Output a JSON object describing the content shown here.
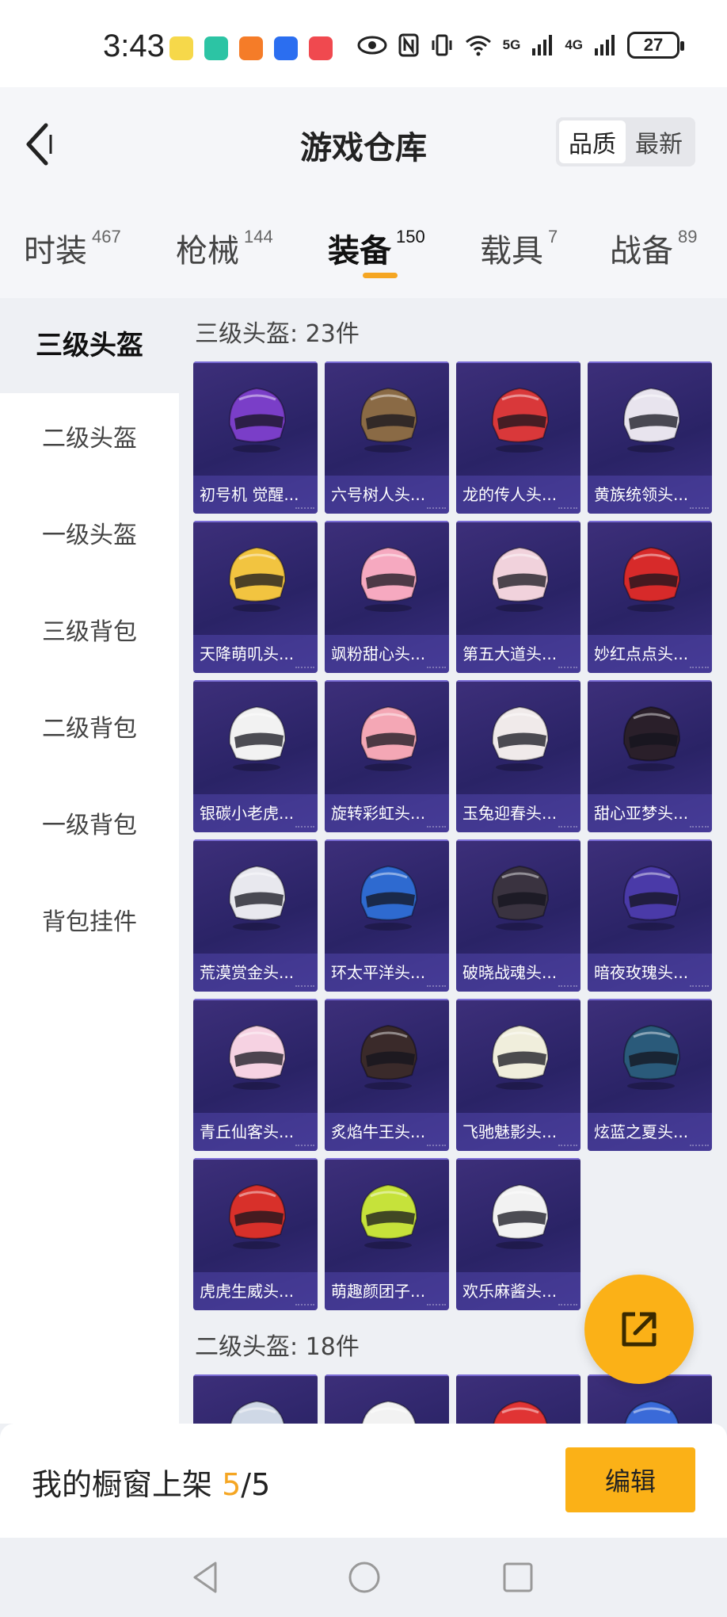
{
  "status_bar": {
    "time": "3:43",
    "network_1": "5G",
    "network_2": "4G",
    "battery": "27"
  },
  "header": {
    "title": "游戏仓库",
    "sort_options": [
      "品质",
      "最新"
    ]
  },
  "category_tabs": [
    {
      "label": "时装",
      "count": "467"
    },
    {
      "label": "枪械",
      "count": "144"
    },
    {
      "label": "装备",
      "count": "150"
    },
    {
      "label": "载具",
      "count": "7"
    },
    {
      "label": "战备",
      "count": "89"
    }
  ],
  "sidebar": {
    "items": [
      "三级头盔",
      "二级头盔",
      "一级头盔",
      "三级背包",
      "二级背包",
      "一级背包",
      "背包挂件"
    ]
  },
  "sections": [
    {
      "title": "三级头盔: 23件",
      "items": [
        "初号机 觉醒...",
        "六号树人头...",
        "龙的传人头...",
        "黄族统领头...",
        "天降萌叽头...",
        "飒粉甜心头...",
        "第五大道头...",
        "妙红点点头...",
        "银碳小老虎...",
        "旋转彩虹头...",
        "玉兔迎春头...",
        "甜心亚梦头...",
        "荒漠赏金头...",
        "环太平洋头...",
        "破晓战魂头...",
        "暗夜玫瑰头...",
        "青丘仙客头...",
        "炙焰牛王头...",
        "飞驰魅影头...",
        "炫蓝之夏头...",
        "虎虎生威头...",
        "萌趣颜团子...",
        "欢乐麻酱头..."
      ]
    },
    {
      "title": "二级头盔: 18件"
    }
  ],
  "bottom_bar": {
    "label": "我的橱窗上架",
    "count": "5",
    "total": "/5",
    "edit_label": "编辑"
  },
  "helmet_colors": [
    "#7a3ec8",
    "#8a6a45",
    "#d9383a",
    "#e8e4ee",
    "#f2c440",
    "#f6a9c0",
    "#f1d2dc",
    "#d72a2a",
    "#f2f2f2",
    "#f4a7b5",
    "#f0eaea",
    "#2a1f2a",
    "#e8e8ee",
    "#2e6ad0",
    "#3a3340",
    "#4a3aa8",
    "#f6d2e2",
    "#3a2a2a",
    "#f0eedc",
    "#2a5a7a",
    "#d8302a",
    "#c6e23a",
    "#f2f2f2"
  ],
  "accent_color": "#f5a623"
}
